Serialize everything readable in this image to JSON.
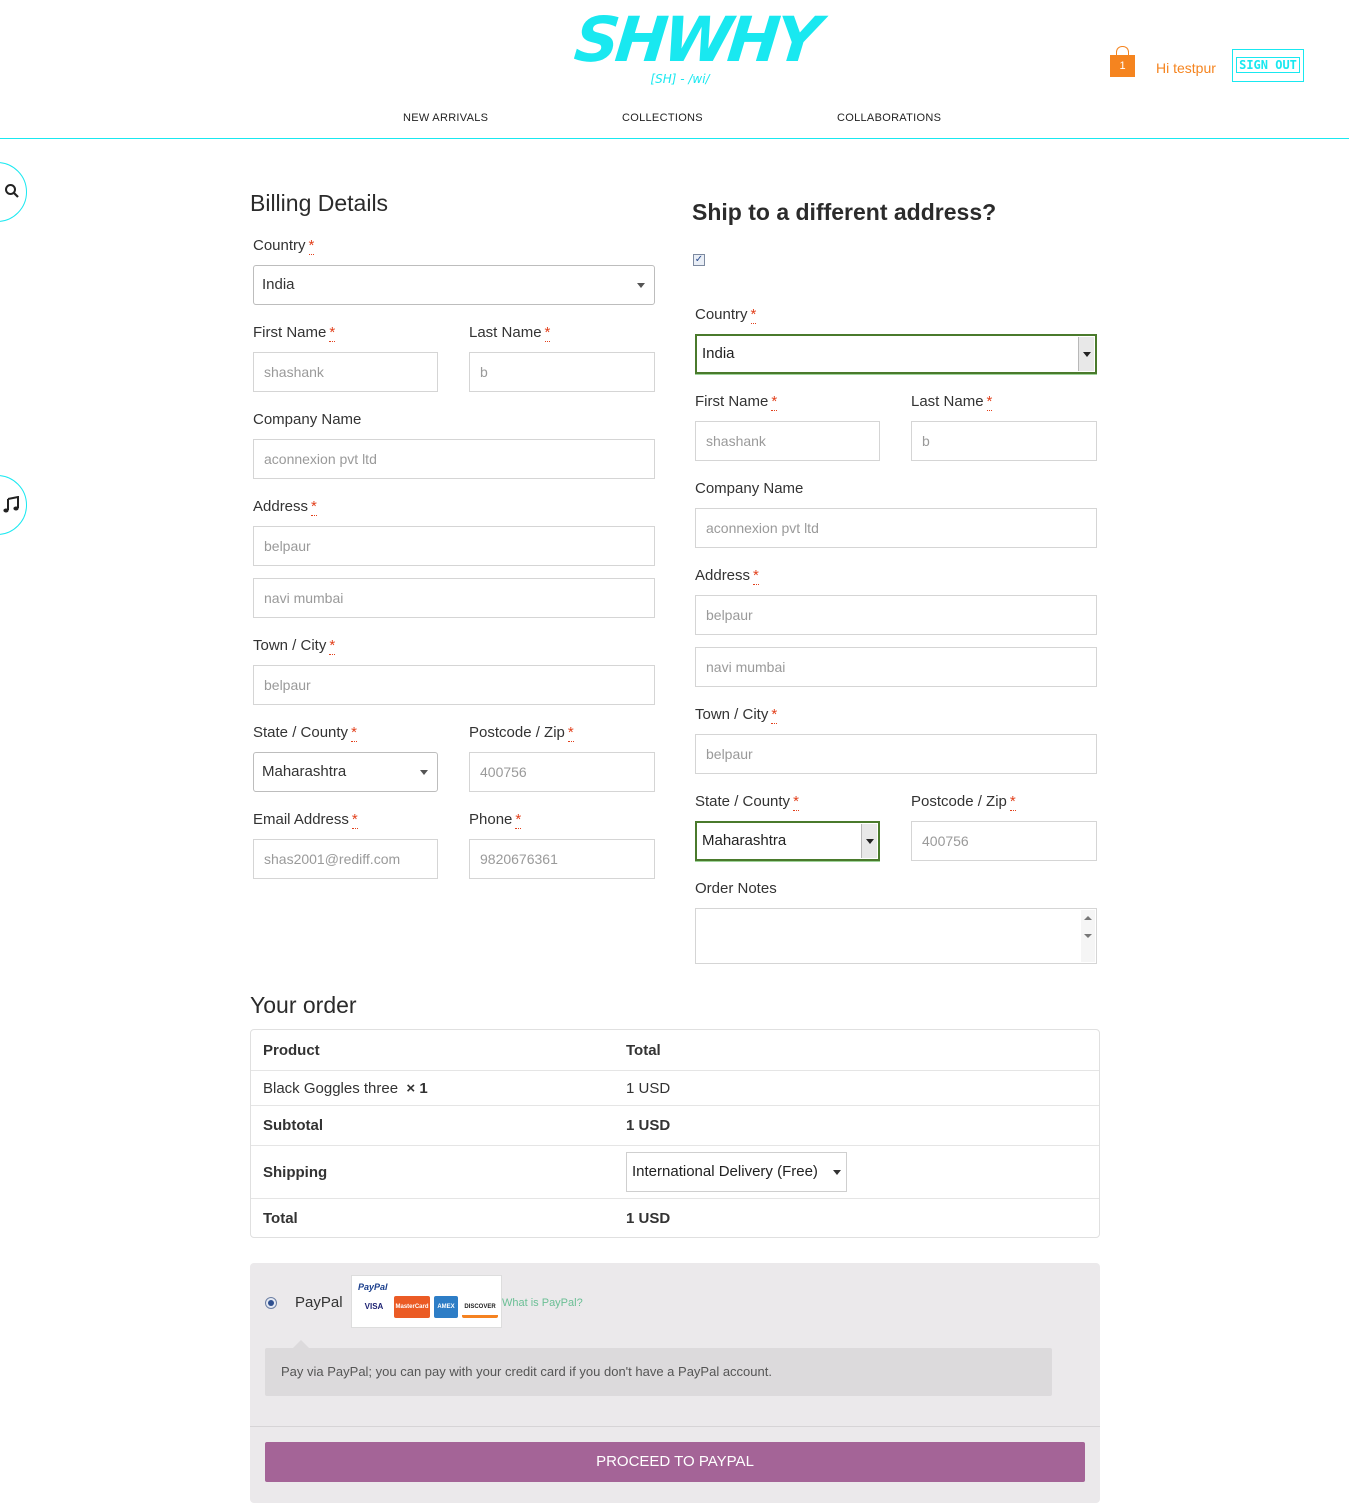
{
  "header": {
    "logo_text": "SHWHY",
    "logo_pronunciation": "[SH] - /wi/",
    "cart_count": "1",
    "greeting": "Hi testpur",
    "signout_label": "SIGN OUT",
    "nav": [
      "NEW ARRIVALS",
      "COLLECTIONS",
      "COLLABORATIONS"
    ]
  },
  "side": {
    "search_icon": "search-icon",
    "music_icon": "music-icon"
  },
  "billing": {
    "title": "Billing Details",
    "country_label": "Country",
    "country_value": "India",
    "first_name_label": "First Name",
    "first_name": "shashank",
    "last_name_label": "Last Name",
    "last_name": "b",
    "company_label": "Company Name",
    "company": "aconnexion pvt ltd",
    "address_label": "Address",
    "address1": "belpaur",
    "address2": "navi mumbai",
    "city_label": "Town / City",
    "city": "belpaur",
    "state_label": "State / County",
    "state_value": "Maharashtra",
    "postcode_label": "Postcode / Zip",
    "postcode": "400756",
    "email_label": "Email Address",
    "email": "shas2001@rediff.com",
    "phone_label": "Phone",
    "phone": "9820676361"
  },
  "shipping": {
    "title": "Ship to a different address?",
    "checkbox_checked": true,
    "country_label": "Country",
    "country_value": "India",
    "first_name_label": "First Name",
    "first_name": "shashank",
    "last_name_label": "Last Name",
    "last_name": "b",
    "company_label": "Company Name",
    "company": "aconnexion pvt ltd",
    "address_label": "Address",
    "address1": "belpaur",
    "address2": "navi mumbai",
    "city_label": "Town / City",
    "city": "belpaur",
    "state_label": "State / County",
    "state_value": "Maharashtra",
    "postcode_label": "Postcode / Zip",
    "postcode": "400756",
    "notes_label": "Order Notes"
  },
  "required_marker": "*",
  "order": {
    "title": "Your order",
    "col_product": "Product",
    "col_total": "Total",
    "item_name": "Black Goggles three",
    "item_qty": "× 1",
    "item_total": "1 USD",
    "subtotal_label": "Subtotal",
    "subtotal": "1 USD",
    "shipping_label": "Shipping",
    "shipping_value": "International Delivery (Free)",
    "total_label": "Total",
    "total": "1 USD"
  },
  "payment": {
    "method": "PayPal",
    "logo_text": "PayPal",
    "cards": [
      "VISA",
      "MasterCard",
      "AMEX",
      "DISCOVER"
    ],
    "what_is": "What is PayPal?",
    "description": "Pay via PayPal; you can pay with your credit card if you don't have a PayPal account.",
    "button": "PROCEED TO PAYPAL"
  },
  "colors": {
    "brand": "#19e8f0",
    "accent": "#f5841f",
    "button": "#a46497",
    "required": "#e2401c"
  }
}
